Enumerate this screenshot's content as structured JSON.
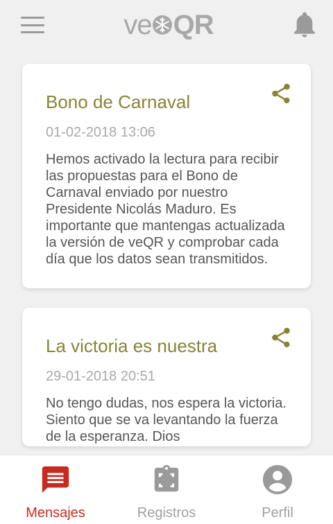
{
  "app": {
    "logo_ve": "ve",
    "logo_qr": "QR"
  },
  "messages": [
    {
      "title": "Bono de Carnaval",
      "date": "01-02-2018 13:06",
      "body": "Hemos activado la lectura para recibir las propuestas para el Bono de Carnaval enviado por nuestro Presidente Nicolás Maduro. Es importante que mantengas actualizada la versión de veQR y comprobar cada día que los datos sean transmitidos."
    },
    {
      "title": "La victoria es nuestra",
      "date": "29-01-2018 20:51",
      "body": "No tengo dudas, nos espera la victoria. Siento que se va levantando la fuerza de la esperanza. Dios"
    }
  ],
  "nav": {
    "items": [
      {
        "label": "Mensajes",
        "icon": "message-icon",
        "active": true
      },
      {
        "label": "Registros",
        "icon": "clipboard-icon",
        "active": false
      },
      {
        "label": "Perfil",
        "icon": "account-icon",
        "active": false
      }
    ]
  },
  "colors": {
    "accent": "#c62b1e",
    "title": "#8a8235",
    "icon_gray": "#9a9a9a"
  }
}
